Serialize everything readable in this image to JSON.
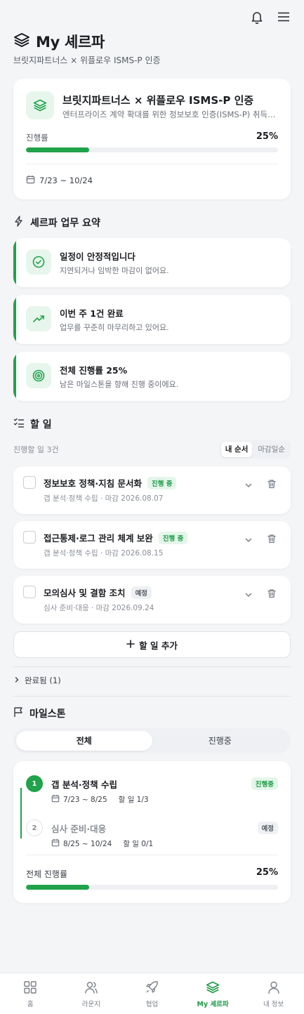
{
  "page": {
    "title": "My 셰르파",
    "subtitle": "브릿지파트너스 × 위플로우 ISMS-P 인증"
  },
  "project": {
    "name": "브릿지파트너스 × 위플로우 ISMS-P 인증",
    "description": "엔터프라이즈 계약 확대를 위한 정보보호 인증(ISMS-P) 취득을 목표로 합니다",
    "progress_label": "진행률",
    "progress_text": "25%",
    "progress_value": 0.25,
    "date_range": "7/23 ~ 10/24"
  },
  "summary": {
    "heading": "셰르파 업무 요약",
    "items": [
      {
        "title": "일정이 안정적입니다",
        "desc": "지연되거나 임박한 마감이 없어요.",
        "icon": "check-circle-icon"
      },
      {
        "title": "이번 주 1건 완료",
        "desc": "업무를 꾸준히 마무리하고 있어요.",
        "icon": "trending-up-icon"
      },
      {
        "title": "전체 진행률 25%",
        "desc": "남은 마일스톤을 향해 진행 중이에요.",
        "icon": "target-icon"
      }
    ]
  },
  "todos": {
    "heading": "할 일",
    "count_text": "진행할 일 3건",
    "sort_options": [
      "내 순서",
      "마감일순"
    ],
    "items": [
      {
        "title": "정보보호 정책·지침 문서화",
        "badge": "진행 중",
        "meta": "갭 분석·정책 수립 · 마감 2026.08.07"
      },
      {
        "title": "접근통제·로그 관리 체계 보완",
        "badge": "진행 중",
        "meta": "갭 분석·정책 수립 · 마감 2026.08.15"
      },
      {
        "title": "모의심사 및 결함 조치",
        "badge": "예정",
        "meta": "심사 준비·대응 · 마감 2026.09.24"
      }
    ],
    "add_label": "할 일 추가",
    "completed_label": "완료됨 (1)"
  },
  "milestones": {
    "heading": "마일스톤",
    "tabs": [
      "전체",
      "진행중"
    ],
    "items": [
      {
        "num": "1",
        "title": "갭 분석·정책 수립",
        "dates": "7/23 ~ 8/25",
        "tasks": "할 일 1/3",
        "badge": "진행중"
      },
      {
        "num": "2",
        "title": "심사 준비·대응",
        "dates": "8/25 ~ 10/24",
        "tasks": "할 일 0/1",
        "badge": "예정"
      }
    ],
    "total_label": "전체 진행률",
    "total_text": "25%",
    "total_value": 0.25
  },
  "nav": {
    "items": [
      {
        "label": "홈",
        "icon": "home-grid-icon"
      },
      {
        "label": "라운지",
        "icon": "users-icon"
      },
      {
        "label": "협업",
        "icon": "rocket-icon"
      },
      {
        "label": "My 셰르파",
        "icon": "layers-icon"
      },
      {
        "label": "내 정보",
        "icon": "user-icon"
      }
    ]
  },
  "colors": {
    "accent": "#20a34a",
    "accent_soft": "#e7f6ec",
    "background": "#f4f5f7"
  }
}
